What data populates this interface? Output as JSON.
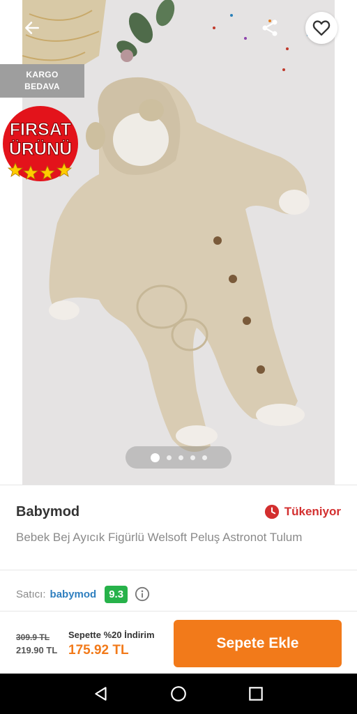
{
  "header": {
    "back_icon": "arrow-left-icon",
    "share_icon": "share-icon",
    "favorite_icon": "heart-outline-icon"
  },
  "badges": {
    "cargo_line1": "KARGO",
    "cargo_line2": "BEDAVA",
    "firsat_line1": "FIRSAT",
    "firsat_line2": "ÜRÜNÜ"
  },
  "carousel": {
    "count": 5,
    "active_index": 0
  },
  "product": {
    "brand": "Babymod",
    "stock_status": "Tükeniyor",
    "stock_icon": "clock-icon",
    "name": "Bebek Bej Ayıcık Figürlü Welsoft Peluş Astronot Tulum"
  },
  "seller": {
    "label": "Satıcı:",
    "name": "babymod",
    "score": "9.3",
    "info_icon": "info-circle-icon"
  },
  "pricing": {
    "old_price": "309.9 TL",
    "mid_price": "219.90 TL",
    "promo_label": "Sepette %20 İndirim",
    "final_price": "175.92 TL",
    "add_to_cart_label": "Sepete Ekle"
  },
  "colors": {
    "accent": "#f27a1a",
    "stock_red": "#d32f2f",
    "seller_blue": "#2f7fbf",
    "score_green": "#27b24a"
  },
  "system_nav": {
    "back": "nav-back-icon",
    "home": "nav-home-icon",
    "recents": "nav-recents-icon"
  }
}
